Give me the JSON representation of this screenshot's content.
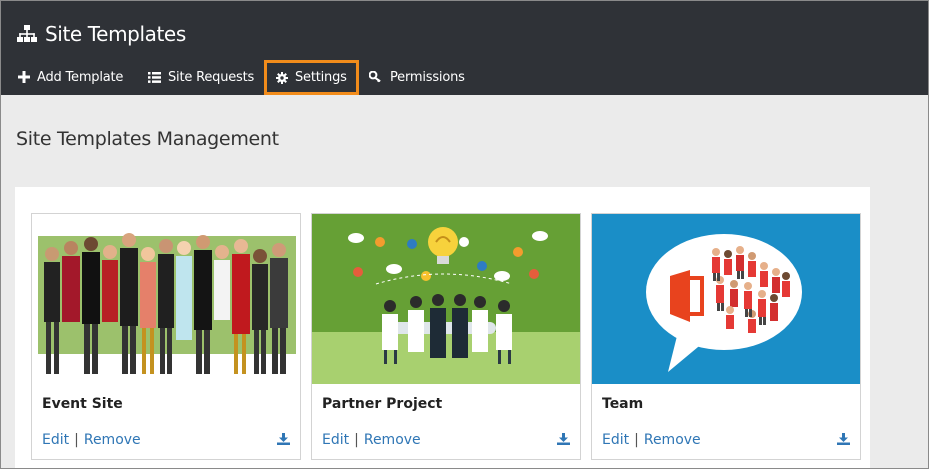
{
  "app": {
    "title": "Site Templates",
    "title_icon": "sitemap-icon"
  },
  "nav": {
    "items": [
      {
        "label": "Add Template",
        "icon": "plus-icon"
      },
      {
        "label": "Site Requests",
        "icon": "list-icon"
      },
      {
        "label": "Settings",
        "icon": "gear-icon",
        "active": true
      },
      {
        "label": "Permissions",
        "icon": "key-icon"
      }
    ]
  },
  "main": {
    "heading": "Site Templates Management"
  },
  "cards": [
    {
      "title": "Event Site",
      "edit_label": "Edit",
      "separator": "|",
      "remove_label": "Remove",
      "image": "party-people-image"
    },
    {
      "title": "Partner Project",
      "edit_label": "Edit",
      "separator": "|",
      "remove_label": "Remove",
      "image": "meeting-ideas-image"
    },
    {
      "title": "Team",
      "edit_label": "Edit",
      "separator": "|",
      "remove_label": "Remove",
      "image": "office-team-image"
    }
  ],
  "colors": {
    "header_bg": "#2f3237",
    "active_outline": "#f28c1b",
    "link": "#2f76b5",
    "page_bg": "#ebebeb",
    "partner_green": "#66a035",
    "team_blue": "#1a8ec7"
  }
}
